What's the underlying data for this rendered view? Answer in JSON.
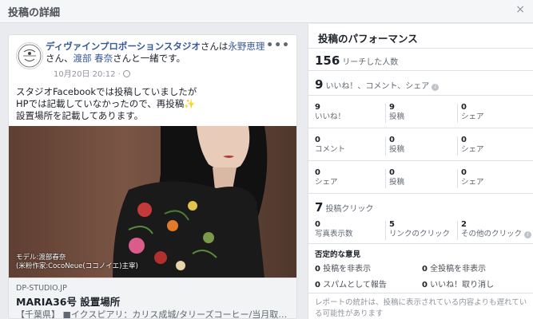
{
  "modal": {
    "title": "投稿の詳細",
    "close": "×"
  },
  "post": {
    "page_name": "ディヴァインプロポーションスタジオ",
    "with_text_1": "さんは",
    "tag1": "永野恵理",
    "with_text_2": "さん、",
    "tag2": "渡部 春奈",
    "with_text_3": "さんと一緒です。",
    "timestamp": "10月20日 20:12 ·",
    "more": "•••",
    "text_lines": [
      "スタジオFacebookでは投稿していましたが",
      "HPでは記載していなかったので、再投稿",
      "設置場所を記載してあります。"
    ],
    "sparkle": "✨",
    "image_caption_1": "モデル:渡部春奈",
    "image_caption_2": "(米粉作家:CocoNeue(ココノイエ)主宰)",
    "link_domain": "DP-STUDIO.JP",
    "link_title": "MARIA36号 設置場所",
    "link_desc": "【千葉県】 ■イクスピアリ：カリス成城/タリーズコーヒー/当月取材店舗..."
  },
  "performance": {
    "title": "投稿のパフォーマンス",
    "reach_num": "156",
    "reach_label": "リーチした人数",
    "engage_num": "9",
    "engage_label": "いいね！、コメント、シェア",
    "grid": [
      [
        {
          "n": "9",
          "l": "いいね！"
        },
        {
          "n": "9",
          "l": "投稿"
        },
        {
          "n": "0",
          "l": "シェア"
        }
      ],
      [
        {
          "n": "0",
          "l": "コメント"
        },
        {
          "n": "0",
          "l": "投稿"
        },
        {
          "n": "0",
          "l": "シェア"
        }
      ],
      [
        {
          "n": "0",
          "l": "シェア"
        },
        {
          "n": "0",
          "l": "投稿"
        },
        {
          "n": "0",
          "l": "シェア"
        }
      ]
    ],
    "clicks_num": "7",
    "clicks_label": "投稿クリック",
    "clicks_grid": [
      {
        "n": "0",
        "l": "写真表示数"
      },
      {
        "n": "5",
        "l": "リンクのクリック"
      },
      {
        "n": "2",
        "l": "その他のクリック"
      }
    ],
    "negative_title": "否定的な意見",
    "negatives": [
      {
        "n": "0",
        "l": "投稿を非表示"
      },
      {
        "n": "0",
        "l": "全投稿を非表示"
      },
      {
        "n": "0",
        "l": "スパムとして報告"
      },
      {
        "n": "0",
        "l": "いいね！取り消し"
      }
    ],
    "footer": "レポートの統計は、投稿に表示されている内容よりも遅れている可能性があります"
  }
}
